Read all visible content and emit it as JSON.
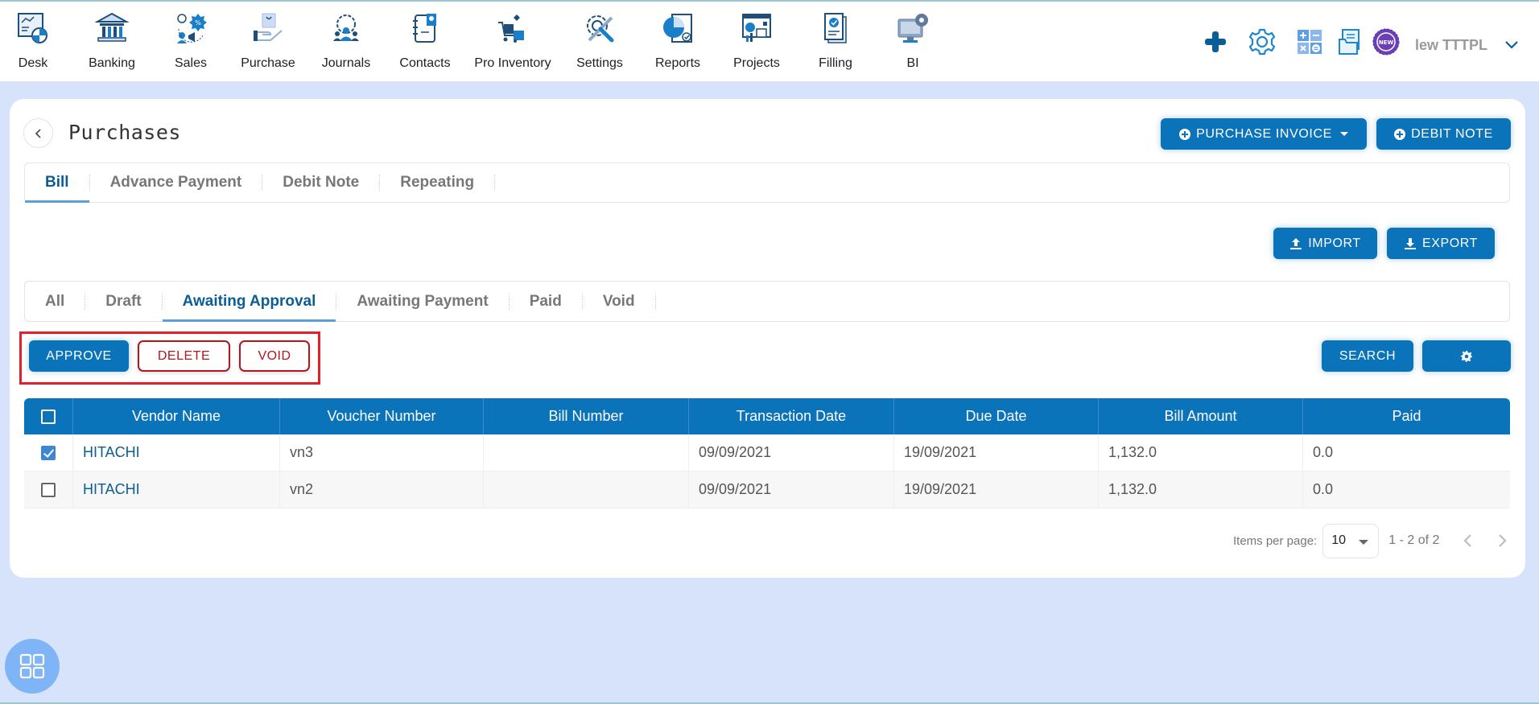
{
  "topnav": {
    "items": [
      {
        "label": "Desk",
        "icon": "desk-icon"
      },
      {
        "label": "Banking",
        "icon": "bank-icon"
      },
      {
        "label": "Sales",
        "icon": "sales-icon"
      },
      {
        "label": "Purchase",
        "icon": "purchase-icon"
      },
      {
        "label": "Journals",
        "icon": "journals-icon"
      },
      {
        "label": "Contacts",
        "icon": "contacts-icon"
      },
      {
        "label": "Pro Inventory",
        "icon": "inventory-icon"
      },
      {
        "label": "Settings",
        "icon": "settings-icon"
      },
      {
        "label": "Reports",
        "icon": "reports-icon"
      },
      {
        "label": "Projects",
        "icon": "projects-icon"
      },
      {
        "label": "Filling",
        "icon": "filling-icon"
      },
      {
        "label": "BI",
        "icon": "bi-icon"
      }
    ],
    "tools": [
      "plus-icon",
      "gear-icon",
      "calculator-icon",
      "documents-icon",
      "new-badge-icon"
    ],
    "new_badge_text": "NEW",
    "user_name": "lew TTTPL"
  },
  "page": {
    "title": "Purchases",
    "purchase_invoice_label": "PURCHASE INVOICE",
    "debit_note_label": "DEBIT NOTE",
    "import_label": "IMPORT",
    "export_label": "EXPORT"
  },
  "main_tabs": [
    {
      "label": "Bill",
      "active": true
    },
    {
      "label": "Advance Payment",
      "active": false
    },
    {
      "label": "Debit Note",
      "active": false
    },
    {
      "label": "Repeating",
      "active": false
    }
  ],
  "status_tabs": [
    {
      "label": "All",
      "active": false
    },
    {
      "label": "Draft",
      "active": false
    },
    {
      "label": "Awaiting Approval",
      "active": true
    },
    {
      "label": "Awaiting Payment",
      "active": false
    },
    {
      "label": "Paid",
      "active": false
    },
    {
      "label": "Void",
      "active": false
    }
  ],
  "actions": {
    "approve_label": "APPROVE",
    "delete_label": "DELETE",
    "void_label": "VOID",
    "search_label": "SEARCH"
  },
  "table": {
    "columns": [
      "Vendor Name",
      "Voucher Number",
      "Bill Number",
      "Transaction Date",
      "Due Date",
      "Bill Amount",
      "Paid"
    ],
    "rows": [
      {
        "checked": true,
        "vendor": "HITACHI",
        "voucher": "vn3",
        "bill_number": "",
        "transaction_date": "09/09/2021",
        "due_date": "19/09/2021",
        "bill_amount": "1,132.0",
        "paid": "0.0"
      },
      {
        "checked": false,
        "vendor": "HITACHI",
        "voucher": "vn2",
        "bill_number": "",
        "transaction_date": "09/09/2021",
        "due_date": "19/09/2021",
        "bill_amount": "1,132.0",
        "paid": "0.0"
      }
    ]
  },
  "pagination": {
    "items_per_page_label": "Items per page:",
    "items_per_page": "10",
    "range": "1 - 2 of 2"
  },
  "colors": {
    "primary": "#0a73b9",
    "danger": "#b3161d",
    "highlight": "#e0212b",
    "background": "#d6e3fb"
  }
}
